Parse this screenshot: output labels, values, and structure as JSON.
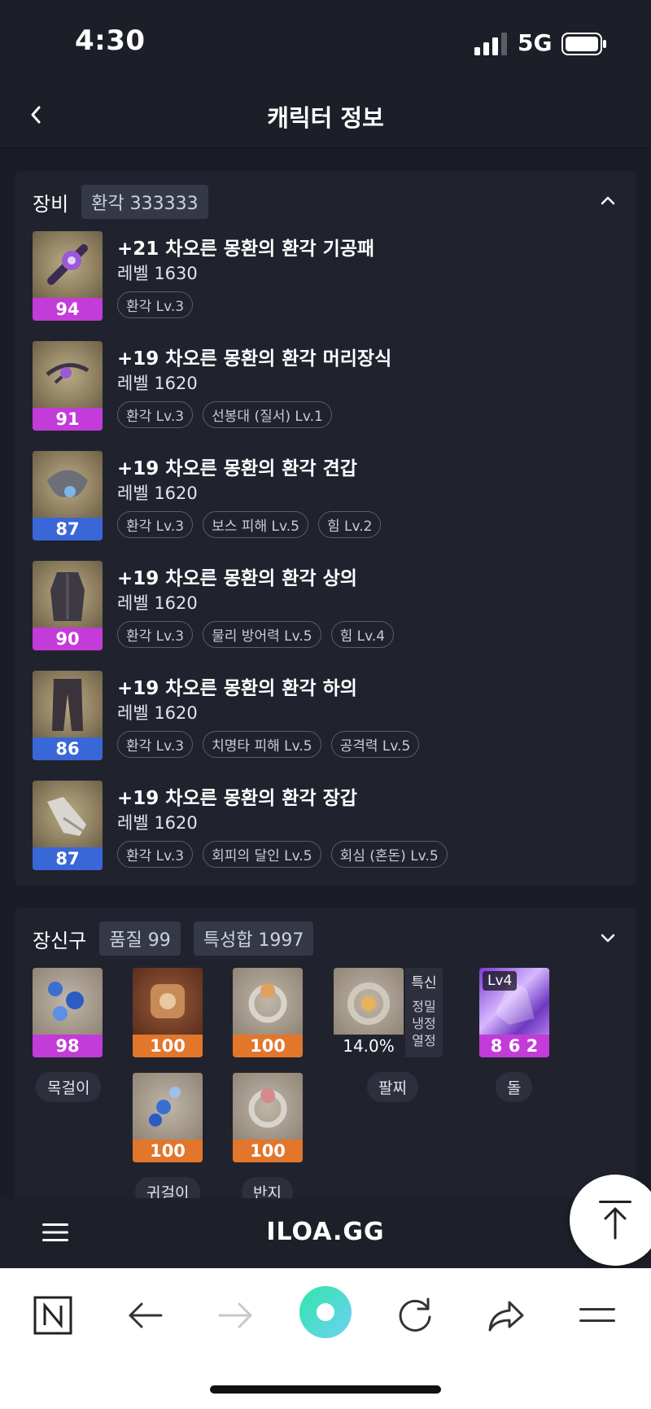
{
  "status": {
    "time": "4:30",
    "network": "5G"
  },
  "header": {
    "title": "캐릭터 정보"
  },
  "equipment": {
    "title": "장비",
    "badge": "환각 333333",
    "items": [
      {
        "name": "+21 차오른 몽환의 환각 기공패",
        "level": "레벨 1630",
        "quality": "94",
        "tier": "purple",
        "tags": [
          "환각 Lv.3"
        ]
      },
      {
        "name": "+19 차오른 몽환의 환각 머리장식",
        "level": "레벨 1620",
        "quality": "91",
        "tier": "purple",
        "tags": [
          "환각 Lv.3",
          "선봉대 (질서) Lv.1"
        ]
      },
      {
        "name": "+19 차오른 몽환의 환각 견갑",
        "level": "레벨 1620",
        "quality": "87",
        "tier": "blue",
        "tags": [
          "환각 Lv.3",
          "보스 피해 Lv.5",
          "힘 Lv.2"
        ]
      },
      {
        "name": "+19 차오른 몽환의 환각 상의",
        "level": "레벨 1620",
        "quality": "90",
        "tier": "purple",
        "tags": [
          "환각 Lv.3",
          "물리 방어력 Lv.5",
          "힘 Lv.4"
        ]
      },
      {
        "name": "+19 차오른 몽환의 환각 하의",
        "level": "레벨 1620",
        "quality": "86",
        "tier": "blue",
        "tags": [
          "환각 Lv.3",
          "치명타 피해 Lv.5",
          "공격력 Lv.5"
        ]
      },
      {
        "name": "+19 차오른 몽환의 환각 장갑",
        "level": "레벨 1620",
        "quality": "87",
        "tier": "blue",
        "tags": [
          "환각 Lv.3",
          "회피의 달인 Lv.5",
          "회심 (혼돈) Lv.5"
        ]
      }
    ]
  },
  "accessories": {
    "title": "장신구",
    "badge_quality": "품질 99",
    "badge_stats": "특성합 1997",
    "necklace": {
      "quality": "98",
      "label": "목걸이"
    },
    "earring1": {
      "quality": "100"
    },
    "earring2": {
      "quality": "100",
      "label": "귀걸이"
    },
    "ring1": {
      "quality": "100"
    },
    "ring2": {
      "quality": "100",
      "label": "반지"
    },
    "bracelet": {
      "percent": "14.0%",
      "label": "팔찌",
      "stats": [
        "특신",
        "정밀",
        "냉정",
        "열정"
      ]
    },
    "stone": {
      "level": "Lv4",
      "value": "8 6 2",
      "label": "돌"
    }
  },
  "appbar": {
    "logo": "ILOA.GG"
  },
  "colors": {
    "purple": "#c33bd8",
    "blue": "#3a67d8",
    "orange": "#e2762b",
    "bg": "#1a1d26"
  }
}
